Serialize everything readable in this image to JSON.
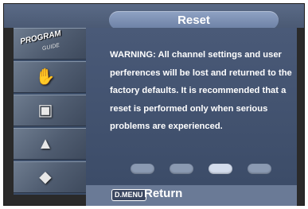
{
  "menu": {
    "title": "Reset",
    "warning": "WARNING: All channel settings and user perferences will be lost and returned to the factory defaults. It is recommended that a reset is performed only when serious problems are experienced."
  },
  "sidebar": {
    "items": [
      {
        "icon": "program-guide-icon",
        "label": "PROGRAM",
        "sublabel": "GUIDE"
      },
      {
        "icon": "channel-icon",
        "glyph": "✋"
      },
      {
        "icon": "picture-icon",
        "glyph": "▣"
      },
      {
        "icon": "sound-icon",
        "glyph": "▲"
      },
      {
        "icon": "setup-icon",
        "glyph": "◆"
      }
    ]
  },
  "pin_indicator": {
    "count": 4,
    "active_index": 2
  },
  "footer": {
    "menu_button": "D.MENU",
    "return_label": "Return"
  },
  "colors": {
    "background": "#3c4c68",
    "title_pill": "#7a8db0",
    "footer": "#6a7a96",
    "text": "#ffffff"
  }
}
